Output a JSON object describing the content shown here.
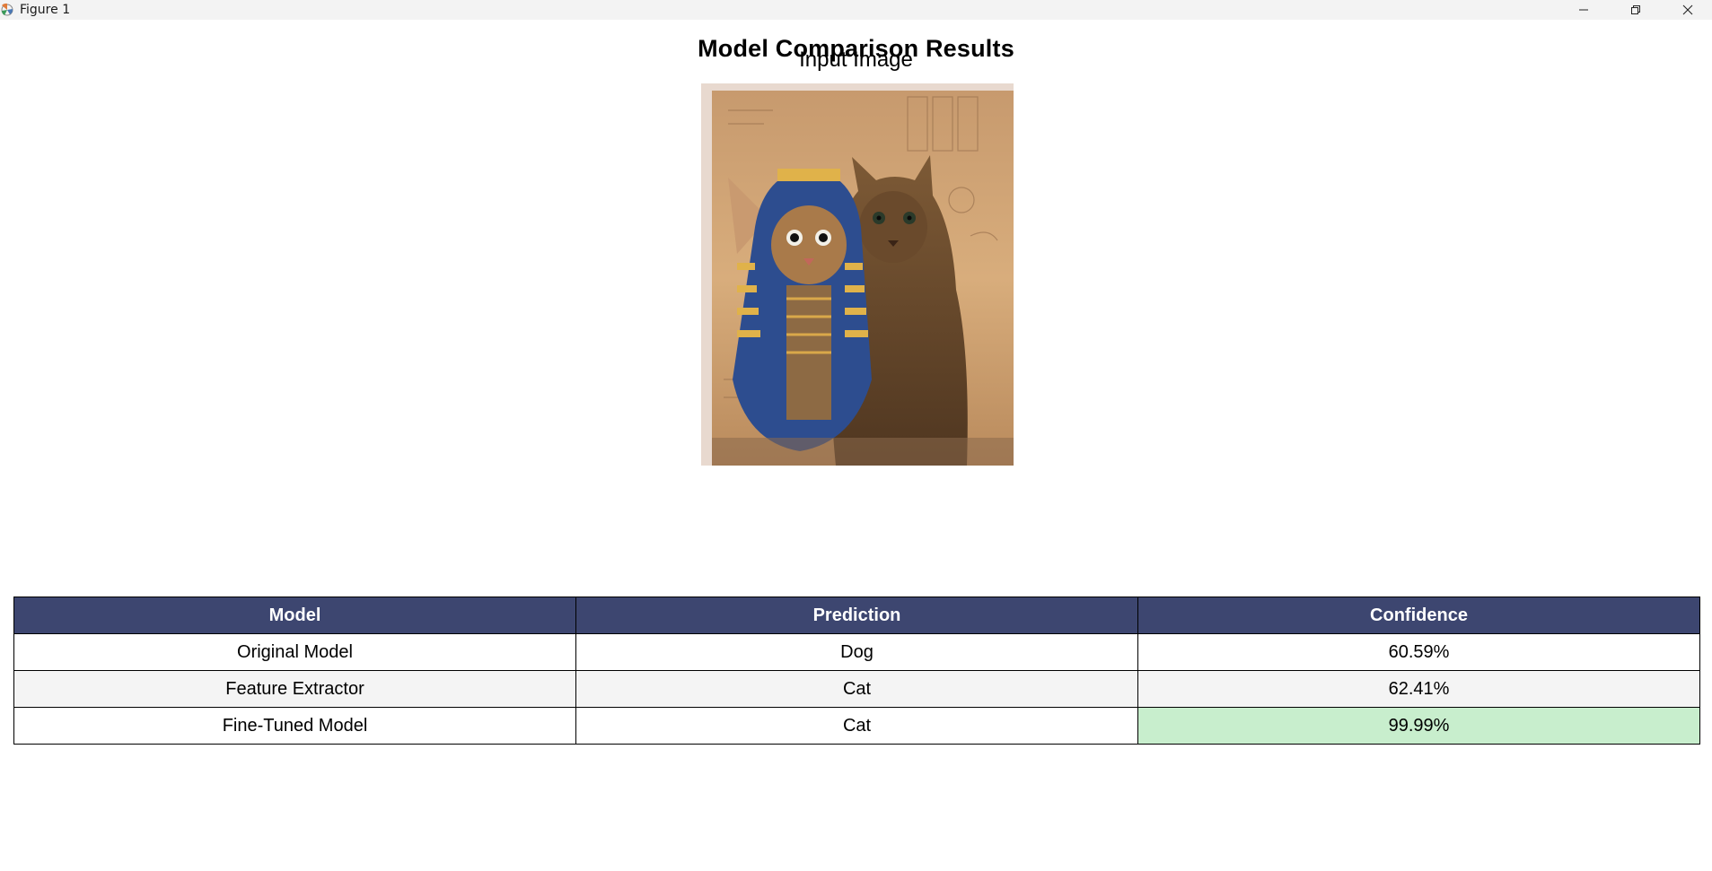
{
  "window": {
    "title": "Figure 1",
    "icons": {
      "app": "matplotlib-icon",
      "minimize": "minimize-icon",
      "maximize": "restore-icon",
      "close": "close-icon"
    }
  },
  "figure": {
    "title": "Model Comparison Results",
    "image_title": "Input Image",
    "image_subject": "cat-pharaoh-artwork"
  },
  "table": {
    "headers": [
      "Model",
      "Prediction",
      "Confidence"
    ],
    "rows": [
      {
        "model": "Original Model",
        "prediction": "Dog",
        "confidence": "60.59%"
      },
      {
        "model": "Feature Extractor",
        "prediction": "Cat",
        "confidence": "62.41%"
      },
      {
        "model": "Fine-Tuned Model",
        "prediction": "Cat",
        "confidence": "99.99%"
      }
    ],
    "colors": {
      "header_bg": "#3d4670",
      "header_text": "#ffffff",
      "highlight": "#c8eecd",
      "alt_row": "#f4f4f4"
    }
  }
}
